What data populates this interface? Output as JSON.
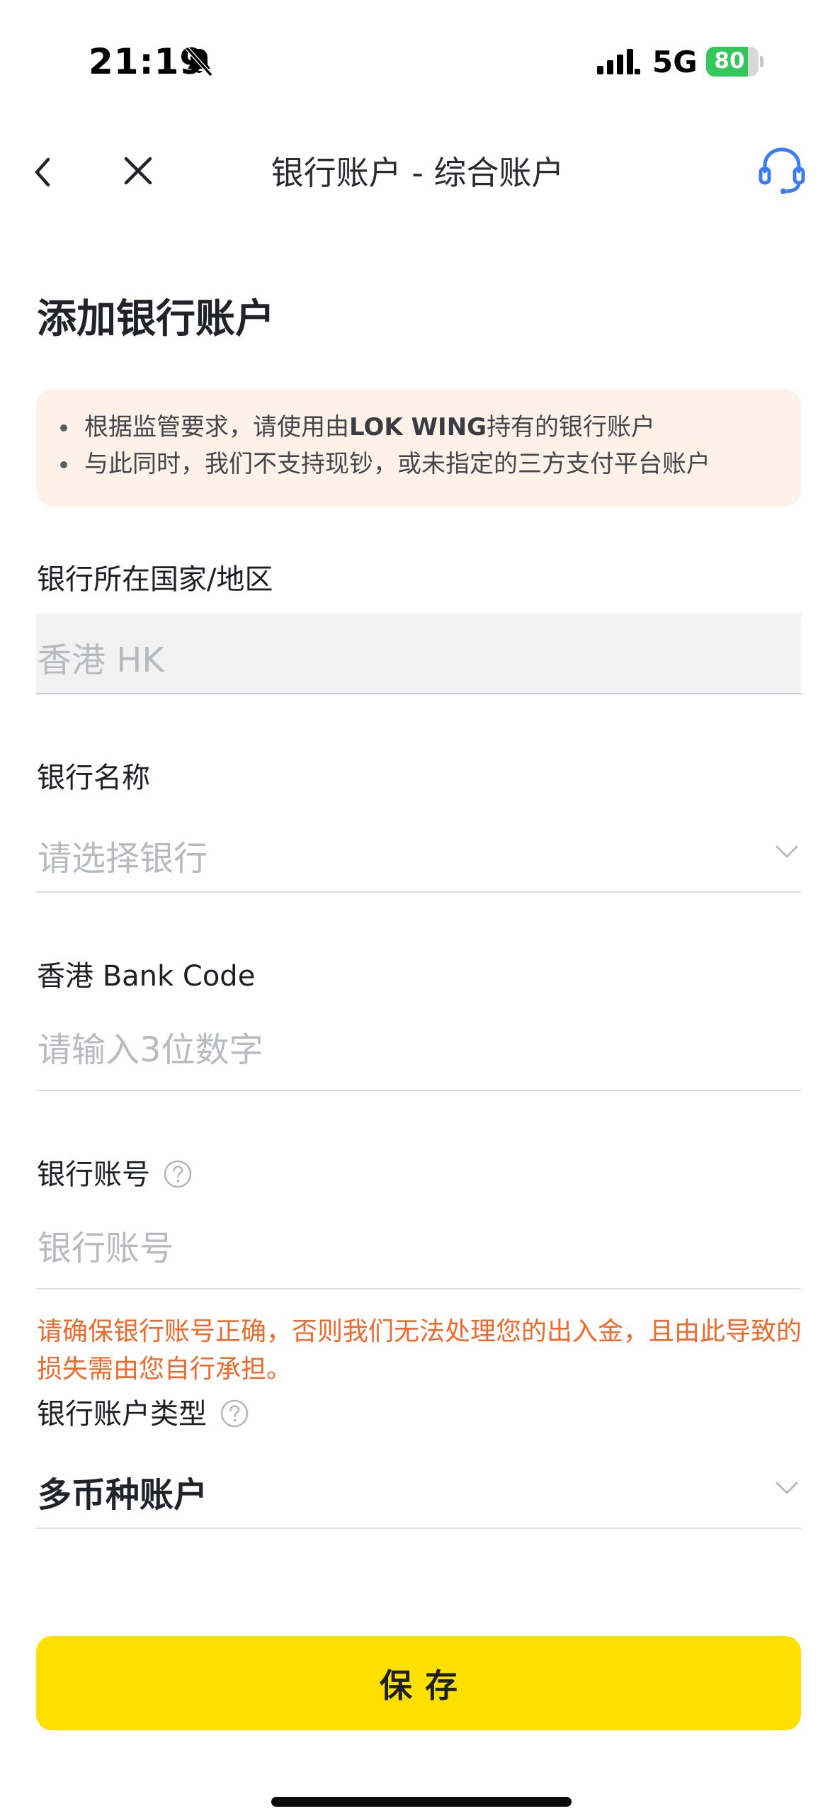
{
  "status_bar": {
    "time": "21:19",
    "network": "5G",
    "battery_percent": 80,
    "battery_label": "80",
    "colors": {
      "battery_fill": "#34c759"
    }
  },
  "nav": {
    "title": "银行账户 - 综合账户",
    "icons": [
      "chevron-left-icon",
      "close-icon",
      "headset-support-icon"
    ]
  },
  "page": {
    "heading": "添加银行账户"
  },
  "notice": {
    "item1_prefix": "根据监管要求，请使用由",
    "item1_bold": "LOK WING",
    "item1_suffix": "持有的银行账户",
    "item2": "与此同时，我们不支持现钞，或未指定的三方支付平台账户"
  },
  "form": {
    "country": {
      "label": "银行所在国家/地区",
      "value": "香港 HK"
    },
    "bank_name": {
      "label": "银行名称",
      "placeholder": "请选择银行"
    },
    "bank_code": {
      "label": "香港 Bank Code",
      "placeholder": "请输入3位数字"
    },
    "account_number": {
      "label": "银行账号",
      "placeholder": "银行账号",
      "warning": "请确保银行账号正确，否则我们无法处理您的出入金，且由此导致的损失需由您自行承担。"
    },
    "account_type": {
      "label": "银行账户类型",
      "value": "多币种账户"
    }
  },
  "actions": {
    "save_label": "保存"
  },
  "colors": {
    "accent_yellow": "#fddf00",
    "warning_orange": "#ee6a2c",
    "notice_background": "#fdf1e8",
    "support_blue": "#3e7bf2"
  }
}
